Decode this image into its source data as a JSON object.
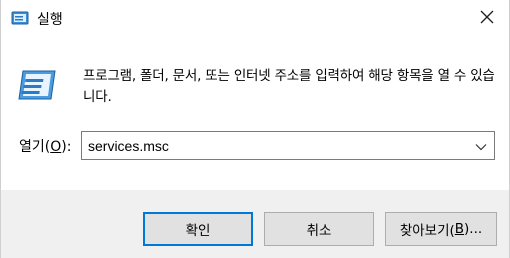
{
  "window": {
    "title": "실행"
  },
  "description": "프로그램, 폴더, 문서, 또는 인터넷 주소를 입력하여 해당 항목을 열 수 있습니다.",
  "open_field": {
    "label_prefix": "열기(",
    "label_accel": "O",
    "label_suffix": "):",
    "value": "services.msc"
  },
  "buttons": {
    "ok": "확인",
    "cancel": "취소",
    "browse_prefix": "찾아보기(",
    "browse_accel": "B",
    "browse_suffix": ")..."
  },
  "icons": {
    "title": "run-icon",
    "main": "run-icon",
    "close": "close-icon",
    "dropdown": "chevron-down-icon"
  },
  "colors": {
    "accent": "#0078d7",
    "footer_bg": "#f0f0f0",
    "button_bg": "#e1e1e1"
  }
}
